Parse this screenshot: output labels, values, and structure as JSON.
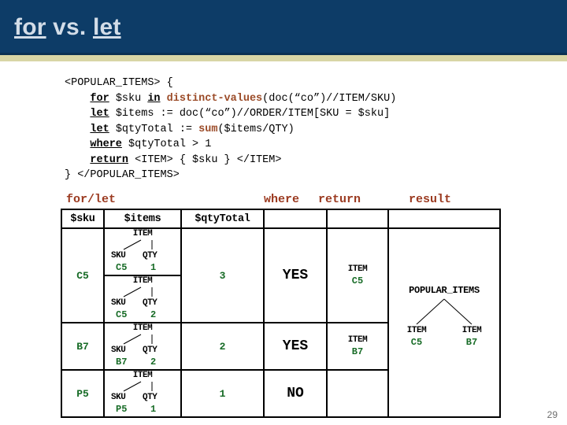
{
  "slide": {
    "title_parts": [
      {
        "text": "for",
        "underline": true
      },
      {
        "text": " vs. ",
        "underline": false
      },
      {
        "text": "let",
        "underline": true
      }
    ],
    "title_plain": "for vs. let",
    "page_number": "29",
    "colors": {
      "header_bg": "#0d3c67",
      "header_band": "#d8d5a5",
      "title_fg": "#d3dde8",
      "caption_fg": "#9b3a20",
      "code_fn_fg": "#9b4b28",
      "value_green": "#176b26"
    }
  },
  "code": {
    "lines": [
      [
        {
          "t": "<POPULAR_ITEMS> {",
          "s": "plain"
        }
      ],
      [
        {
          "t": "    ",
          "s": "plain"
        },
        {
          "t": "for",
          "s": "kw"
        },
        {
          "t": " $sku ",
          "s": "plain"
        },
        {
          "t": "in",
          "s": "kw"
        },
        {
          "t": " ",
          "s": "plain"
        },
        {
          "t": "distinct-values",
          "s": "fn"
        },
        {
          "t": "(doc(“co”)//ITEM/SKU)",
          "s": "plain"
        }
      ],
      [
        {
          "t": "    ",
          "s": "plain"
        },
        {
          "t": "let",
          "s": "kw"
        },
        {
          "t": " $items := doc(“co”)//ORDER/ITEM[SKU = $sku]",
          "s": "plain"
        }
      ],
      [
        {
          "t": "    ",
          "s": "plain"
        },
        {
          "t": "let",
          "s": "kw"
        },
        {
          "t": " $qtyTotal := ",
          "s": "plain"
        },
        {
          "t": "sum",
          "s": "fn"
        },
        {
          "t": "($items/QTY)",
          "s": "plain"
        }
      ],
      [
        {
          "t": "    ",
          "s": "plain"
        },
        {
          "t": "where",
          "s": "kw"
        },
        {
          "t": " $qtyTotal > 1",
          "s": "plain"
        }
      ],
      [
        {
          "t": "    ",
          "s": "plain"
        },
        {
          "t": "return",
          "s": "kw"
        },
        {
          "t": " <ITEM> { $sku } </ITEM>",
          "s": "plain"
        }
      ],
      [
        {
          "t": "} </POPULAR_ITEMS>",
          "s": "plain"
        }
      ]
    ]
  },
  "captions": {
    "forlet": "for/let",
    "where": "where",
    "return": "return",
    "result": "result"
  },
  "table": {
    "headers": {
      "sku": "$sku",
      "items": "$items",
      "qtytotal": "$qtyTotal",
      "where": "",
      "return": "",
      "result": ""
    },
    "rows": [
      {
        "sku": "C5",
        "items": [
          {
            "root": "ITEM",
            "left_label": "SKU",
            "right_label": "QTY",
            "left_value": "C5",
            "right_value": "1"
          },
          {
            "root": "ITEM",
            "left_label": "SKU",
            "right_label": "QTY",
            "left_value": "C5",
            "right_value": "2"
          }
        ],
        "qtytotal": "3",
        "where": "YES",
        "return": {
          "name": "ITEM",
          "value": "C5"
        }
      },
      {
        "sku": "B7",
        "items": [
          {
            "root": "ITEM",
            "left_label": "SKU",
            "right_label": "QTY",
            "left_value": "B7",
            "right_value": "2"
          }
        ],
        "qtytotal": "2",
        "where": "YES",
        "return": {
          "name": "ITEM",
          "value": "B7"
        }
      },
      {
        "sku": "P5",
        "items": [
          {
            "root": "ITEM",
            "left_label": "SKU",
            "right_label": "QTY",
            "left_value": "P5",
            "right_value": "1"
          }
        ],
        "qtytotal": "1",
        "where": "NO",
        "return": {
          "name": "",
          "value": ""
        }
      }
    ],
    "result": {
      "root": "POPULAR_ITEMS",
      "children": [
        {
          "name": "ITEM",
          "value": "C5"
        },
        {
          "name": "ITEM",
          "value": "B7"
        }
      ]
    }
  }
}
